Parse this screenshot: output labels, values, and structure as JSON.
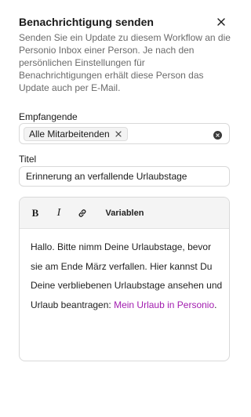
{
  "dialog": {
    "title": "Benachrichtigung senden",
    "description": "Senden Sie ein Update zu diesem Workflow an die Personio Inbox einer Person. Je nach den persönlichen Einstellungen für Benachrichtigungen erhält diese Person das Update auch per E-Mail."
  },
  "recipients": {
    "label": "Empfangende",
    "chips": [
      "Alle Mitarbeitenden"
    ]
  },
  "title_field": {
    "label": "Titel",
    "value": "Erinnerung an verfallende Urlaubstage"
  },
  "editor": {
    "toolbar": {
      "bold": "B",
      "italic": "I",
      "variables": "Variablen"
    },
    "body_text": "Hallo. Bitte nimm Deine Urlaubstage, bevor sie am Ende März verfallen. Hier kannst Du Deine verbliebenen Urlaubstage ansehen und Urlaub beantragen: ",
    "link_text": "Mein Urlaub in Personio",
    "trailing_text": "."
  },
  "colors": {
    "link": "#a21caf",
    "toolbar_bg": "#f4f4f4",
    "border": "#d9d9d9"
  },
  "icons": [
    "close-icon",
    "chip-remove-icon",
    "clear-icon",
    "link-icon"
  ]
}
